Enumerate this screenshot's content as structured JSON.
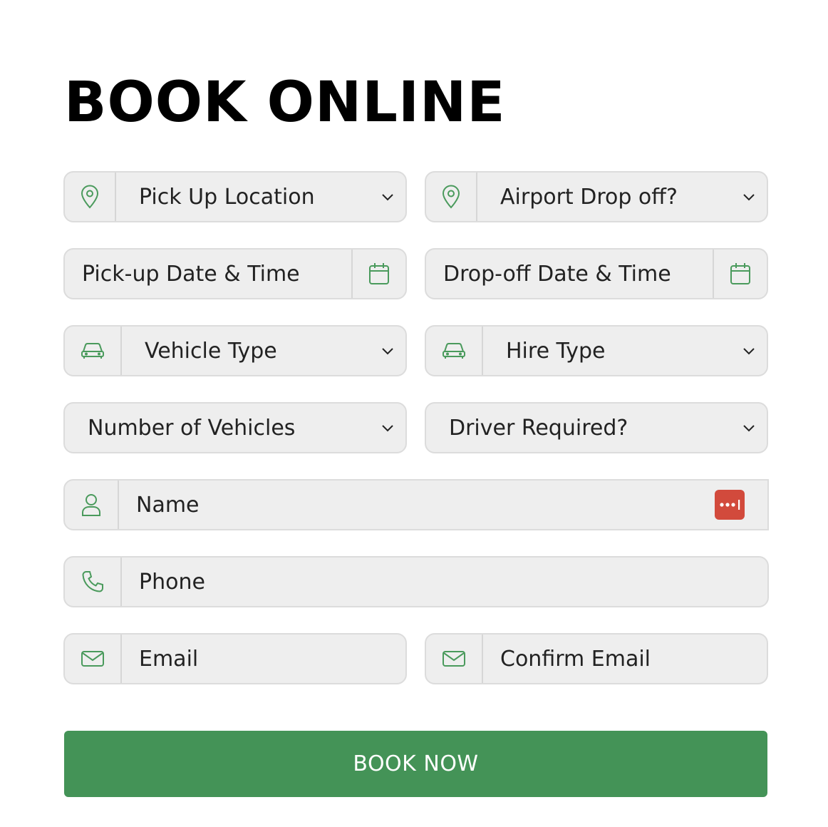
{
  "form": {
    "title": "BOOK ONLINE",
    "pickup_location": {
      "value": "Pick Up Location",
      "icon": "map-pin-icon"
    },
    "airport_dropoff": {
      "value": "Airport Drop off?",
      "icon": "map-pin-icon"
    },
    "pickup_datetime": {
      "placeholder": "Pick-up Date & Time",
      "icon": "calendar-icon"
    },
    "dropoff_datetime": {
      "placeholder": "Drop-off Date & Time",
      "icon": "calendar-icon"
    },
    "vehicle_type": {
      "value": "Vehicle Type",
      "icon": "car-icon"
    },
    "hire_type": {
      "value": "Hire Type",
      "icon": "car-icon"
    },
    "number_of_vehicles": {
      "value": "Number of Vehicles"
    },
    "driver_required": {
      "value": "Driver Required?"
    },
    "name": {
      "placeholder": "Name",
      "icon": "user-icon",
      "autofill_icon": "password-manager-icon"
    },
    "phone": {
      "placeholder": "Phone",
      "icon": "phone-icon"
    },
    "email": {
      "placeholder": "Email",
      "icon": "mail-icon"
    },
    "confirm_email": {
      "placeholder": "Confirm Email",
      "icon": "mail-icon"
    },
    "submit_label": "BOOK NOW"
  },
  "colors": {
    "accent": "#449357",
    "icon": "#4a9a5c",
    "field_bg": "#eeeeee",
    "field_border": "#dcdcdc",
    "password_badge": "#d24a3c"
  }
}
